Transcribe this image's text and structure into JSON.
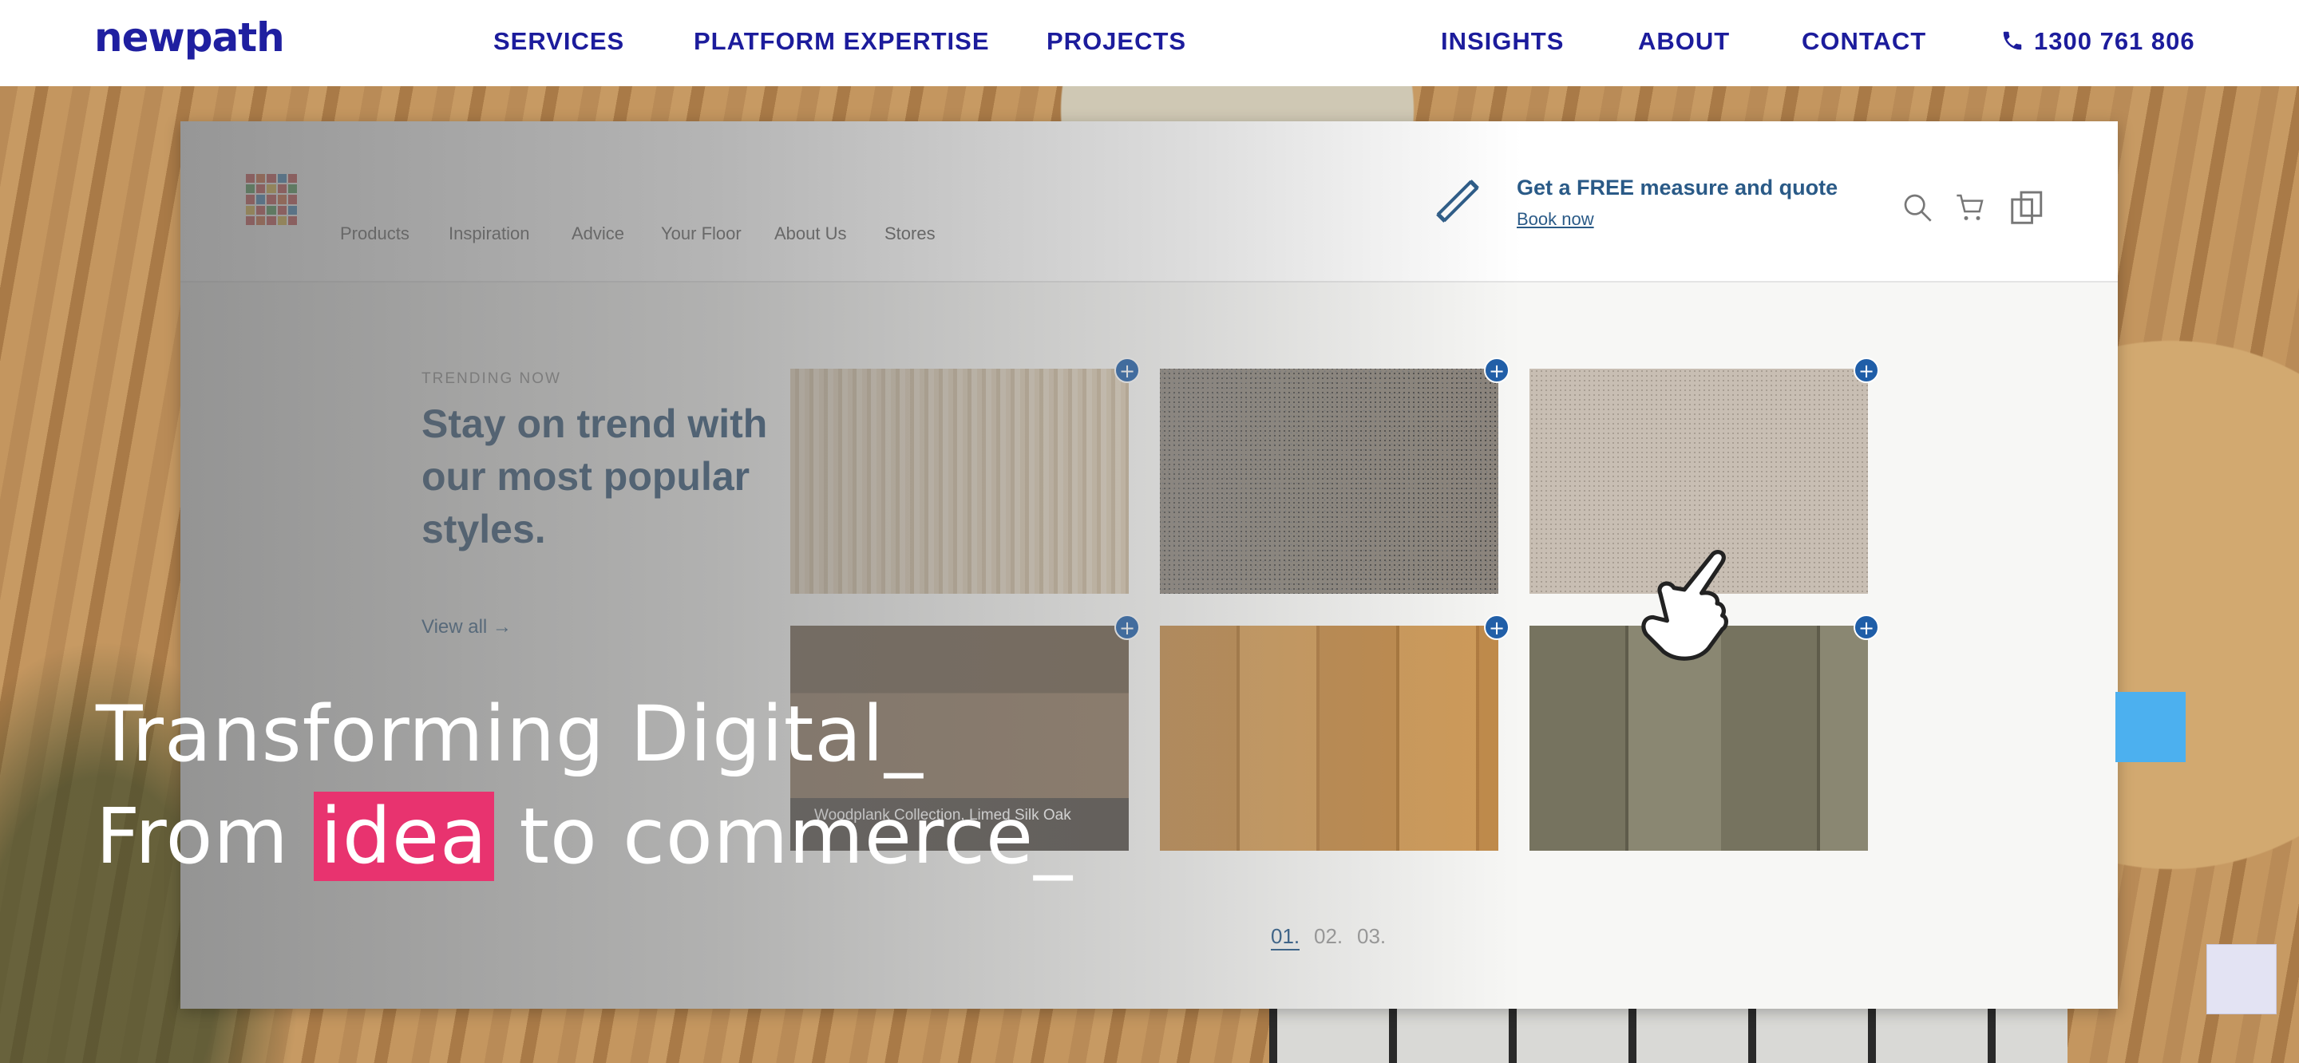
{
  "brand": {
    "logo": "newpath"
  },
  "nav": {
    "items": [
      "SERVICES",
      "PLATFORM EXPERTISE",
      "PROJECTS",
      "INSIGHTS",
      "ABOUT",
      "CONTACT"
    ],
    "phone": "1300 761 806"
  },
  "preview": {
    "menu": [
      "Products",
      "Inspiration",
      "Advice",
      "Your Floor",
      "About Us",
      "Stores"
    ],
    "promo_title": "Get a FREE measure and quote",
    "promo_link": "Book now",
    "kicker": "TRENDING NOW",
    "title": "Stay on trend with our most popular styles.",
    "view_all": "View all  →",
    "tile_caption": "Woodplank Collection, Limed Silk Oak",
    "pages": [
      "01.",
      "02.",
      "03."
    ]
  },
  "hero": {
    "line1": "Transforming Digital_",
    "line2_before": "From ",
    "line2_highlight": "idea",
    "line2_after": " to commerce_"
  },
  "colors": {
    "brand": "#1c1c9c",
    "highlight": "#e8336f",
    "accent_square": "#4cb0ef"
  }
}
